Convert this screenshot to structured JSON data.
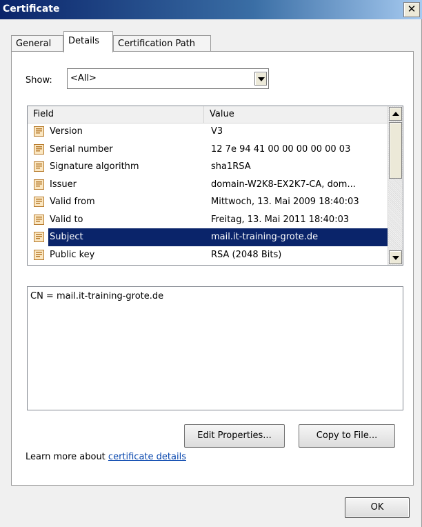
{
  "window": {
    "title": "Certificate",
    "close_glyph": "✕"
  },
  "tabs": [
    {
      "label": "General"
    },
    {
      "label": "Details"
    },
    {
      "label": "Certification Path"
    }
  ],
  "show": {
    "label": "Show:",
    "value": "<All>"
  },
  "list": {
    "columns": {
      "field": "Field",
      "value": "Value"
    },
    "rows": [
      {
        "field": "Version",
        "value": "V3",
        "icon": "certificate-field-icon"
      },
      {
        "field": "Serial number",
        "value": "12 7e 94 41 00 00 00 00 00 03",
        "icon": "certificate-field-icon"
      },
      {
        "field": "Signature algorithm",
        "value": "sha1RSA",
        "icon": "certificate-field-icon"
      },
      {
        "field": "Issuer",
        "value": "domain-W2K8-EX2K7-CA, dom...",
        "icon": "certificate-field-icon"
      },
      {
        "field": "Valid from",
        "value": "Mittwoch, 13. Mai 2009 18:40:03",
        "icon": "certificate-field-icon"
      },
      {
        "field": "Valid to",
        "value": "Freitag, 13. Mai 2011 18:40:03",
        "icon": "certificate-field-icon"
      },
      {
        "field": "Subject",
        "value": "mail.it-training-grote.de",
        "icon": "certificate-field-icon",
        "selected": true
      },
      {
        "field": "Public key",
        "value": "RSA (2048 Bits)",
        "icon": "certificate-field-icon"
      }
    ]
  },
  "detail": {
    "text": "CN = mail.it-training-grote.de"
  },
  "buttons": {
    "edit": "Edit Properties...",
    "copy": "Copy to File...",
    "ok": "OK"
  },
  "learn": {
    "prefix": "Learn more about ",
    "link": "certificate details"
  },
  "colors": {
    "selection": "#0a246a",
    "title_bar": "#0a246a",
    "link": "#0645ad"
  }
}
